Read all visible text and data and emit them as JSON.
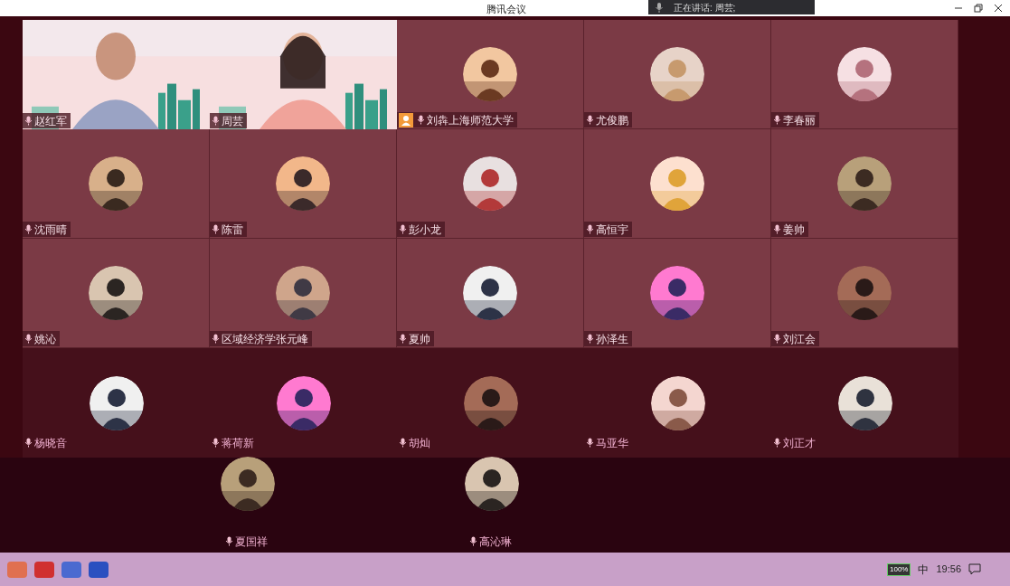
{
  "window": {
    "title": "腾讯会议",
    "speaking": "正在讲话: 周芸;"
  },
  "grid": [
    {
      "name": "赵红军",
      "kind": "video",
      "badge": false
    },
    {
      "name": "周芸",
      "kind": "video",
      "badge": false
    },
    {
      "name": "刘犇上海师范大学",
      "kind": "avatar",
      "badge": true
    },
    {
      "name": "尤俊鹏",
      "kind": "avatar",
      "badge": false
    },
    {
      "name": "李春丽",
      "kind": "avatar",
      "badge": false
    },
    {
      "name": "沈雨晴",
      "kind": "avatar",
      "badge": false
    },
    {
      "name": "陈雷",
      "kind": "avatar",
      "badge": false
    },
    {
      "name": "彭小龙",
      "kind": "avatar",
      "badge": false
    },
    {
      "name": "高恒宇",
      "kind": "avatar",
      "badge": false
    },
    {
      "name": "姜帅",
      "kind": "avatar",
      "badge": false
    },
    {
      "name": "姚沁",
      "kind": "avatar",
      "badge": false
    },
    {
      "name": "区域经济学张元峰",
      "kind": "avatar",
      "badge": false
    },
    {
      "name": "夏帅",
      "kind": "avatar",
      "badge": false
    },
    {
      "name": "孙泽生",
      "kind": "avatar",
      "badge": false
    },
    {
      "name": "刘江会",
      "kind": "avatar",
      "badge": false
    }
  ],
  "lower_grid": [
    {
      "name": "杨晓音"
    },
    {
      "name": "蒋荷新"
    },
    {
      "name": "胡灿"
    },
    {
      "name": "马亚华"
    },
    {
      "name": "刘正才"
    }
  ],
  "bottom_row": [
    {
      "name": "夏国祥"
    },
    {
      "name": "高沁琳"
    }
  ],
  "taskbar": {
    "battery": "100%",
    "ime": "中",
    "time": "19:56"
  }
}
